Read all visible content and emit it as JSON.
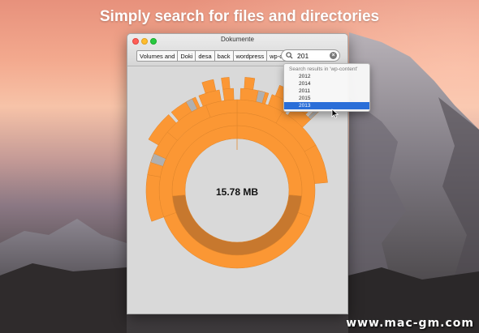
{
  "headline": "Simply search for files and directories",
  "window": {
    "title": "Dokumente",
    "breadcrumbs": [
      "Volumes and",
      "Doki",
      "desa",
      "back",
      "wordpress",
      "wp-content"
    ]
  },
  "search": {
    "value": "201",
    "clear_label": "×"
  },
  "dropdown": {
    "header": "Search results in 'wp-content'",
    "items": [
      "2012",
      "2014",
      "2011",
      "2015",
      "2013"
    ],
    "selected_index": 4
  },
  "chart": {
    "total_label": "15.78 MB"
  },
  "colors": {
    "accent_selected": "#2a6ed8",
    "segment_orange": "#fb9734",
    "segment_highlight": "#c7782e",
    "segment_gray": "#b0b0b0"
  },
  "watermark": "www.mac-gm.com"
}
